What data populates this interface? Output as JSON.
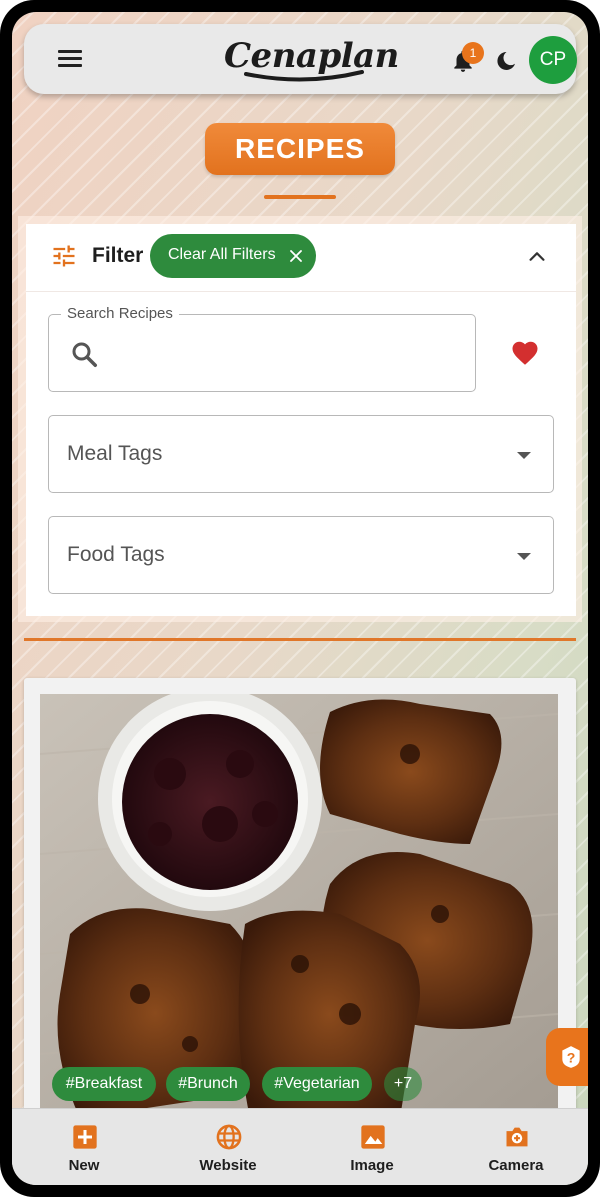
{
  "app": {
    "brand": "Cenaplan",
    "notification_count": "1",
    "avatar_initials": "CP"
  },
  "page": {
    "title": "RECIPES"
  },
  "filter": {
    "label": "Filter",
    "clear_all_label": "Clear All Filters",
    "search_label": "Search Recipes",
    "search_value": "",
    "meal_tags_label": "Meal Tags",
    "food_tags_label": "Food Tags"
  },
  "recipe": {
    "image_alt": "French toast slices with berry compote",
    "tags": [
      "#Breakfast",
      "#Brunch",
      "#Vegetarian"
    ],
    "more_tags": "+7"
  },
  "bottom_nav": {
    "items": [
      {
        "label": "New",
        "icon": "add-box-icon"
      },
      {
        "label": "Website",
        "icon": "globe-icon"
      },
      {
        "label": "Image",
        "icon": "image-icon"
      },
      {
        "label": "Camera",
        "icon": "camera-icon"
      }
    ]
  },
  "colors": {
    "accent": "#e2721e",
    "green": "#2e8b3d",
    "heart": "#d32f2f",
    "avatar": "#1e9e3e"
  }
}
